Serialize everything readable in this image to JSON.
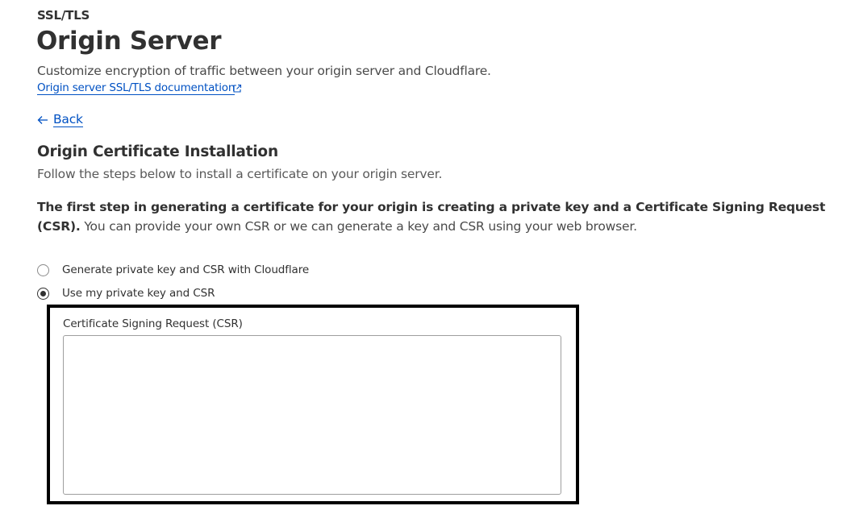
{
  "header": {
    "eyebrow": "SSL/TLS",
    "title": "Origin Server",
    "subtitle": "Customize encryption of traffic between your origin server and Cloudflare.",
    "doc_link": "Origin server SSL/TLS documentation",
    "doc_link_icon": "external-link-icon"
  },
  "nav": {
    "back_label": "Back",
    "back_icon": "arrow-left-icon"
  },
  "section": {
    "title": "Origin Certificate Installation",
    "description": "Follow the steps below to install a certificate on your origin server.",
    "paragraph_bold": "The first step in generating a certificate for your origin is creating a private key and a Certificate Signing Request (CSR).",
    "paragraph_rest": " You can provide your own CSR or we can generate a key and CSR using your web browser."
  },
  "options": [
    {
      "label": "Generate private key and CSR with Cloudflare",
      "selected": false
    },
    {
      "label": "Use my private key and CSR",
      "selected": true
    }
  ],
  "csr": {
    "label": "Certificate Signing Request (CSR)",
    "value": "",
    "placeholder": ""
  },
  "colors": {
    "link": "#0051c3",
    "text": "#313131",
    "highlight_border": "#000000"
  }
}
